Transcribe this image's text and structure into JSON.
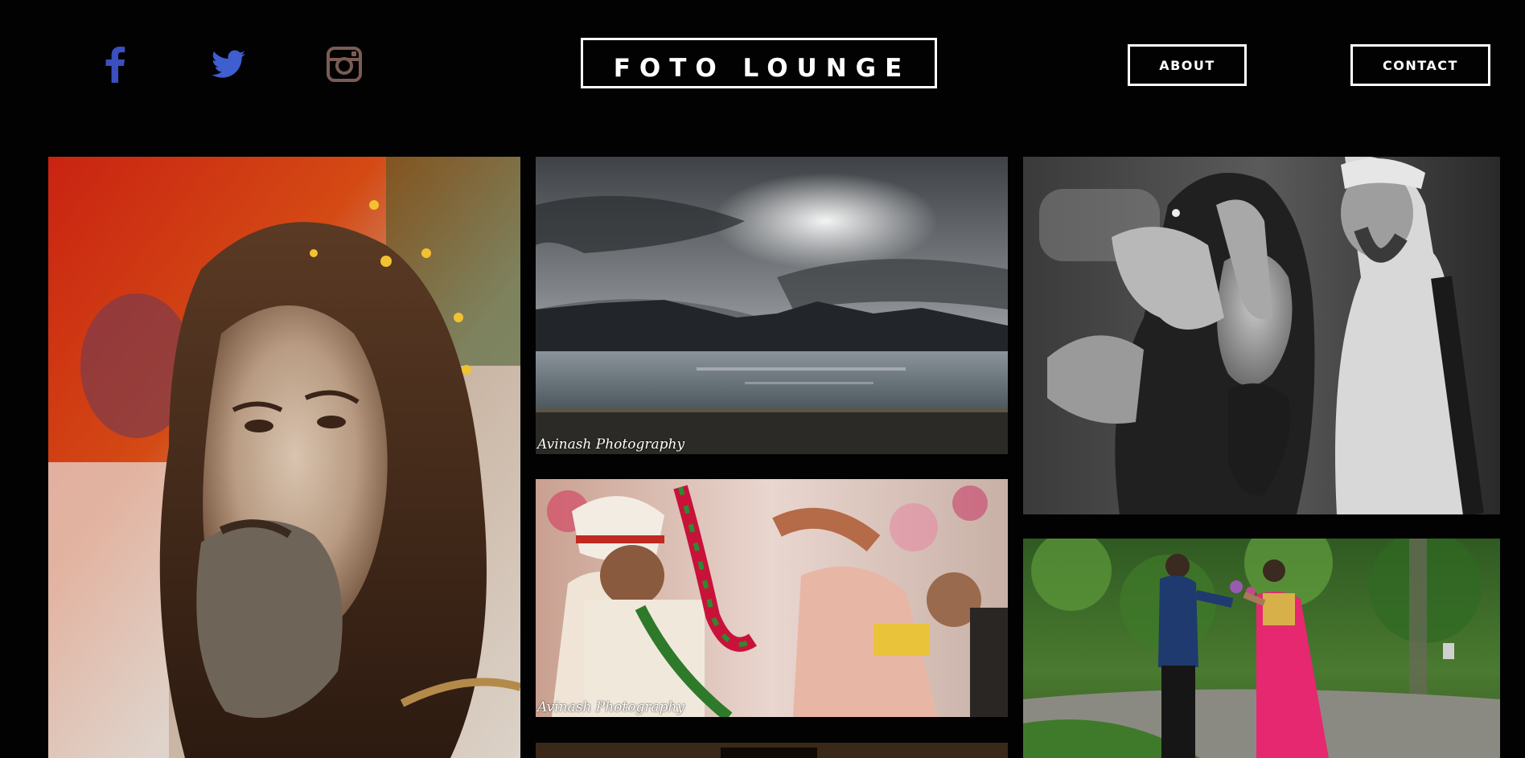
{
  "header": {
    "logo_text": "FOTO LOUNGE",
    "nav": {
      "about_label": "ABOUT",
      "contact_label": "CONTACT"
    },
    "social": [
      {
        "icon": "facebook-icon",
        "color": "#3b4fc0"
      },
      {
        "icon": "twitter-icon",
        "color": "#3f5ed0"
      },
      {
        "icon": "instagram-icon",
        "color": "#7a5c55"
      }
    ]
  },
  "gallery": {
    "watermark_text": "Avinash Photography",
    "tiles": [
      {
        "name": "portrait-sadhu-color",
        "watermark": ""
      },
      {
        "name": "mountain-lake-landscape",
        "watermark": "Avinash Photography"
      },
      {
        "name": "wedding-garland-ceremony",
        "watermark": "Avinash Photography"
      },
      {
        "name": "sadhu-black-white",
        "watermark": ""
      },
      {
        "name": "couple-forest-prewedding",
        "watermark": ""
      },
      {
        "name": "partial-tile-bottom",
        "watermark": ""
      }
    ]
  },
  "colors": {
    "background": "#020202",
    "text": "#ffffff",
    "facebook": "#3b4fc0",
    "twitter": "#3f5ed0",
    "instagram": "#7a5c55"
  }
}
